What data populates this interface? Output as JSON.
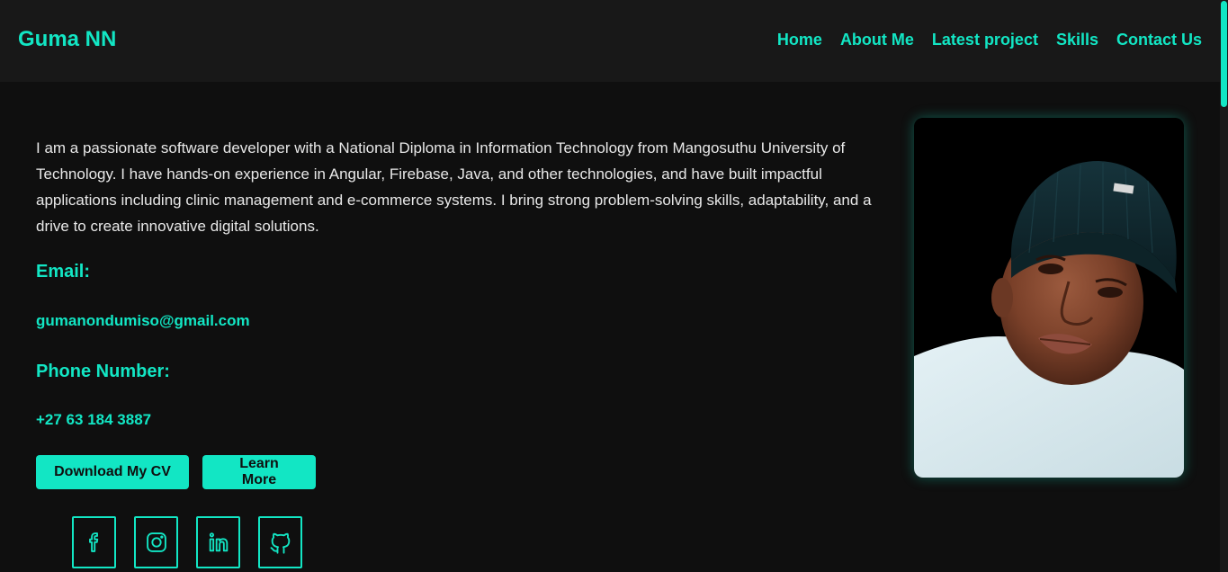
{
  "header": {
    "brand": "Guma NN",
    "nav": [
      "Home",
      "About Me",
      "Latest project",
      "Skills",
      "Contact Us"
    ]
  },
  "about": {
    "intro": "I am a passionate software developer with a National Diploma in Information Technology from Mangosuthu University of Technology. I have hands-on experience in Angular, Firebase, Java, and other technologies, and have built impactful applications including clinic management and e-commerce systems. I bring strong problem-solving skills, adaptability, and a drive to create innovative digital solutions.",
    "email_label": "Email:",
    "email": "gumanondumiso@gmail.com",
    "phone_label": "Phone Number:",
    "phone": "+27 63 184 3887"
  },
  "buttons": {
    "download_cv": "Download My CV",
    "learn_more": "Learn More"
  },
  "socials": [
    "facebook-icon",
    "instagram-icon",
    "linkedin-icon",
    "github-icon"
  ],
  "colors": {
    "accent": "#12e6c4",
    "background": "#0f0f0f",
    "header_background": "#181818",
    "text": "#e8e8e8"
  }
}
